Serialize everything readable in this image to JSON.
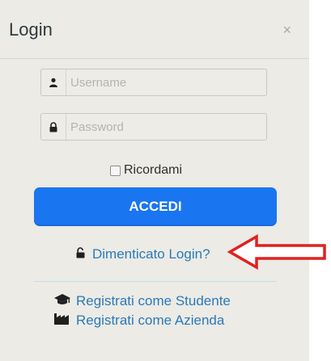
{
  "dialog": {
    "title": "Login",
    "close_symbol": "×"
  },
  "fields": {
    "username": {
      "placeholder": "Username",
      "value": "",
      "icon": "user-icon"
    },
    "password": {
      "placeholder": "Password",
      "value": "",
      "icon": "lock-icon"
    }
  },
  "remember": {
    "label": "Ricordami",
    "checked": false
  },
  "submit": {
    "label": "ACCEDI",
    "color": "#1a75f0"
  },
  "forgot": {
    "label": "Dimenticato Login?",
    "icon": "unlock-icon",
    "color": "#2a7ab8"
  },
  "register": {
    "student": {
      "label": "Registrati come Studente",
      "icon": "graduation-cap-icon"
    },
    "company": {
      "label": "Registrati come Azienda",
      "icon": "industry-icon"
    }
  },
  "annotation": {
    "type": "arrow",
    "color": "#e02020",
    "points_to": "forgot"
  }
}
